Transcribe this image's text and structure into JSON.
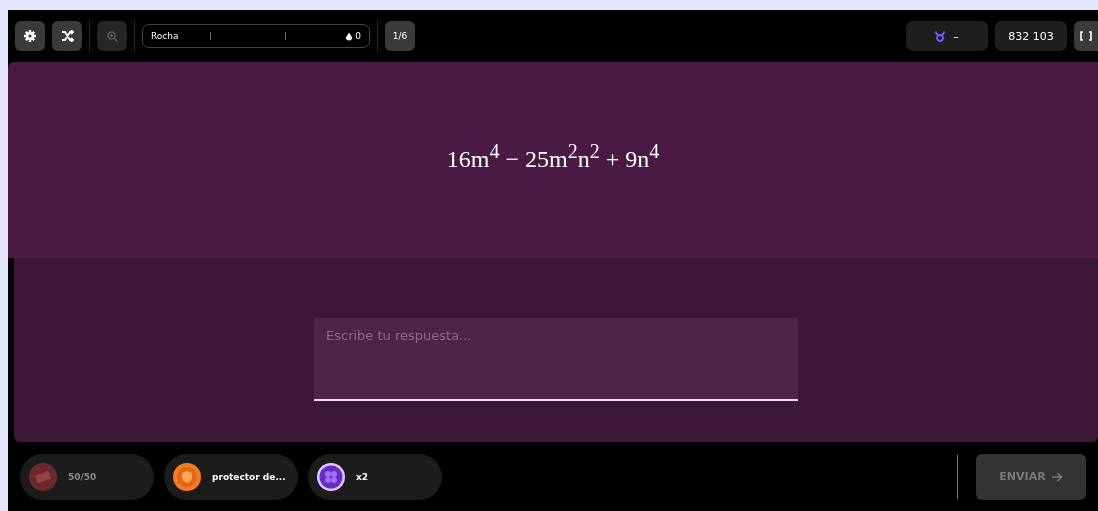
{
  "toolbar": {
    "streak": {
      "label": "Rocha",
      "count": "0"
    },
    "progress": "1/6",
    "zoom_disabled": true,
    "sign": "–",
    "score": "832 103"
  },
  "question": {
    "expression": "16m$^{4}$ − 25m$^{2}$n$^{2}$ + 9n$^{4}$"
  },
  "answer": {
    "placeholder": "Escribe tu respuesta..."
  },
  "powerups": [
    {
      "kind": "fifty",
      "label": "50/50",
      "disabled": true
    },
    {
      "kind": "shield",
      "label": "protector de...",
      "disabled": false
    },
    {
      "kind": "double",
      "label": "x2",
      "disabled": false
    }
  ],
  "submit": {
    "label": "ENVIAR",
    "disabled": true
  }
}
